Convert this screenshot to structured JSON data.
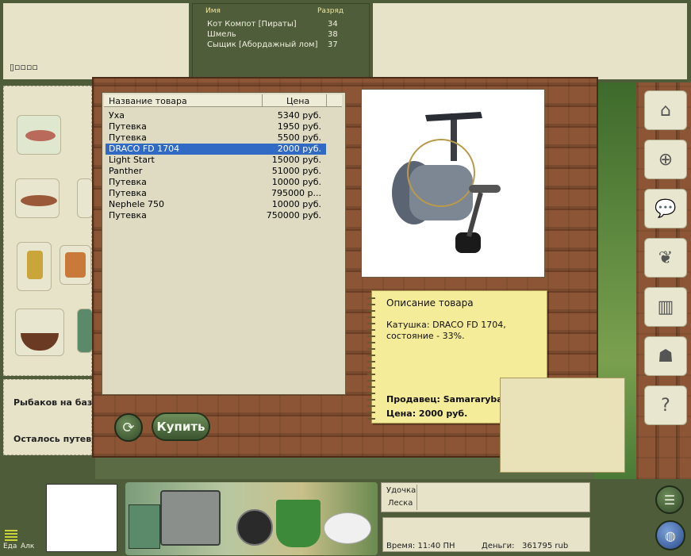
{
  "top": {
    "players": {
      "col_name": "Имя",
      "col_rank": "Разряд",
      "rows": [
        {
          "name": "Кот Компот [Пираты]",
          "rank": "34"
        },
        {
          "name": "Шмель",
          "rank": "38"
        },
        {
          "name": "Сыщик [Абордажный лом]",
          "rank": "37"
        }
      ]
    }
  },
  "left": {
    "fishers_label": "Рыбаков на базе:",
    "remaining_label": "Осталось путевки"
  },
  "shop": {
    "col_name": "Название товара",
    "col_price": "Цена",
    "items": [
      {
        "name": "Уха",
        "price": "5340 руб."
      },
      {
        "name": "Путевка",
        "price": "1950 руб."
      },
      {
        "name": "Путевка",
        "price": "5500 руб."
      },
      {
        "name": "DRACO FD 1704",
        "price": "2000 руб."
      },
      {
        "name": "Light Start",
        "price": "15000 руб."
      },
      {
        "name": "Panther",
        "price": "51000 руб."
      },
      {
        "name": "Путевка",
        "price": "10000 руб."
      },
      {
        "name": "Путевка",
        "price": "795000 р..."
      },
      {
        "name": "Nephele 750",
        "price": "10000 руб."
      },
      {
        "name": "Путевка",
        "price": "750000 руб."
      }
    ],
    "selected_index": 3,
    "buy_label": "Купить",
    "description": {
      "title": "Описание товара",
      "text_line1": "Катушка: DRACO FD 1704,",
      "text_line2": "состояние - 33%.",
      "seller": "Продавец: Samararyba",
      "price": "Цена: 2000 руб."
    }
  },
  "bottom": {
    "rod_label": "Удочка",
    "line_label": "Леска",
    "time": "Время: 11:40 ПН",
    "money": "Деньги:   361795 rub",
    "food_label": "Еда",
    "alc_label": "Алк"
  },
  "colors": {
    "accent_select": "#316ac5",
    "panel_beige": "#e6e3c9",
    "note_yellow": "#f5ec9a"
  }
}
